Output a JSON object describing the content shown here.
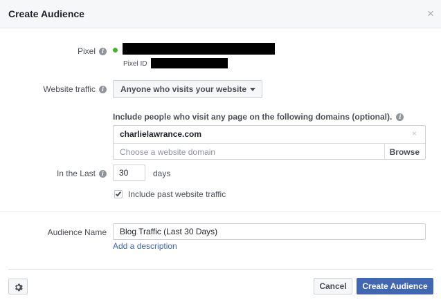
{
  "dialog": {
    "title": "Create Audience",
    "close_glyph": "×"
  },
  "pixel": {
    "label": "Pixel",
    "status_color": "#42b72a",
    "id_label": "Pixel ID"
  },
  "website_traffic": {
    "label": "Website traffic",
    "selected": "Anyone who visits your website"
  },
  "domains": {
    "instruction": "Include people who visit any page on the following domains (optional).",
    "chips": [
      "charlielawrance.com"
    ],
    "remove_glyph": "×",
    "placeholder": "Choose a website domain",
    "browse_label": "Browse"
  },
  "in_the_last": {
    "label": "In the Last",
    "value": "30",
    "unit": "days"
  },
  "past_traffic": {
    "checked": true,
    "label": "Include past website traffic"
  },
  "audience_name": {
    "label": "Audience Name",
    "value": "Blog Traffic (Last 30 Days)",
    "add_description": "Add a description"
  },
  "footer": {
    "cancel_label": "Cancel",
    "create_label": "Create Audience"
  },
  "icons": {
    "info": "info-icon",
    "gear": "gear-icon",
    "close": "close-icon",
    "caret": "caret-down-icon"
  },
  "colors": {
    "primary": "#4267b2",
    "link": "#4267b2",
    "header_bg": "#f6f7f9"
  }
}
